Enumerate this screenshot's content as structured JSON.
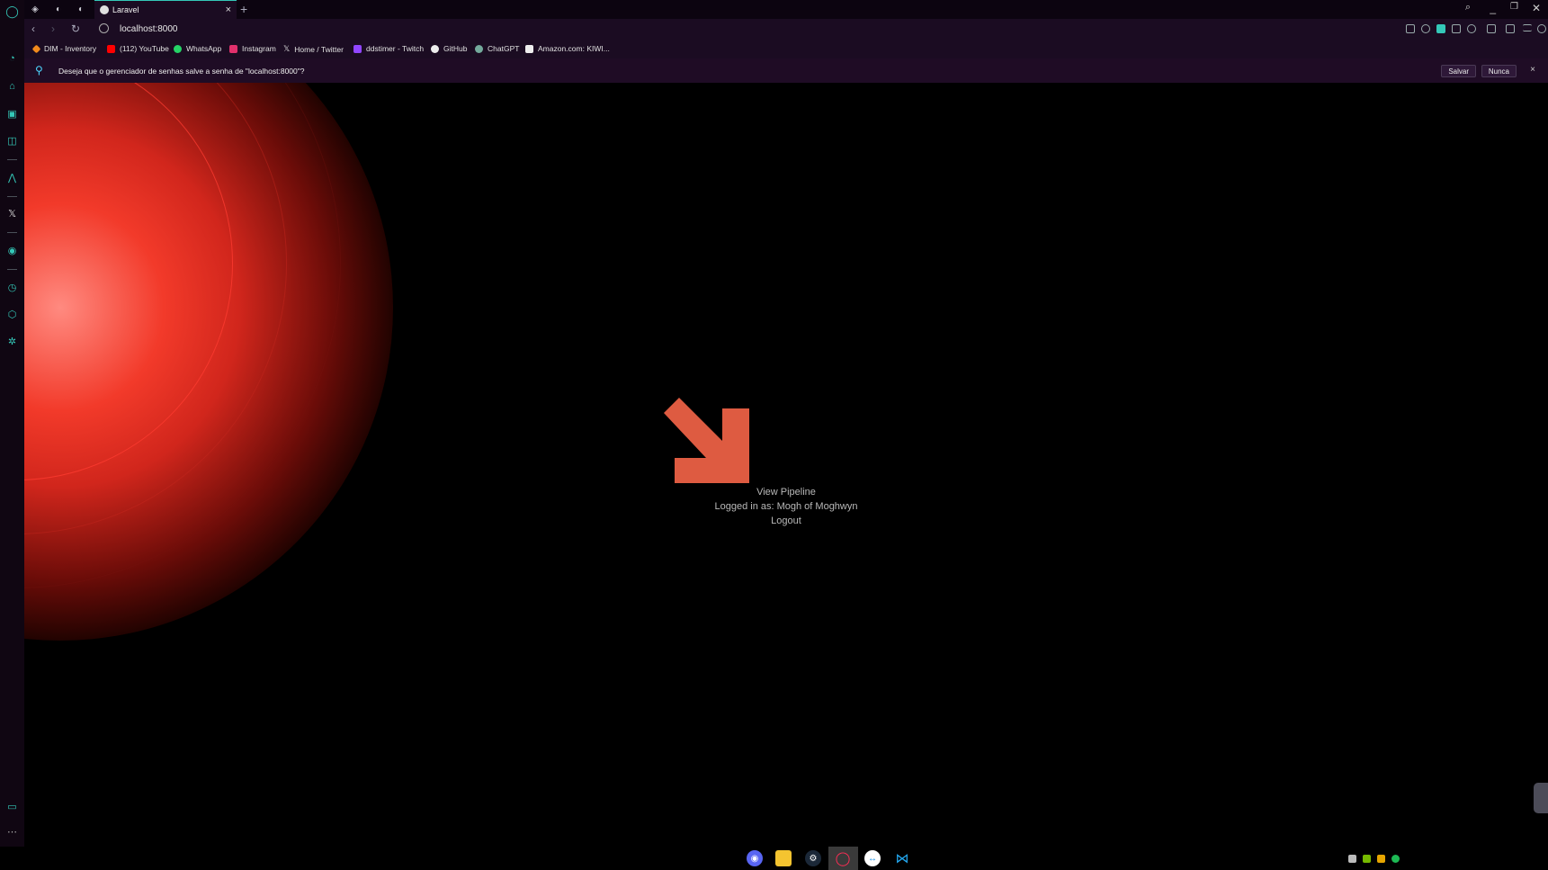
{
  "browser": {
    "active_tab_title": "Laravel",
    "new_tab_glyph": "+",
    "close_tab_glyph": "×",
    "url": "localhost:8000",
    "accent_color": "#34c8b8"
  },
  "bookmarks": [
    {
      "label": "DIM - Inventory",
      "icon": "dim-icon",
      "color": "#f08a1c"
    },
    {
      "label": "(112) YouTube",
      "icon": "youtube-icon",
      "color": "#ff0000"
    },
    {
      "label": "WhatsApp",
      "icon": "whatsapp-icon",
      "color": "#25d366"
    },
    {
      "label": "Instagram",
      "icon": "instagram-icon",
      "color": "#e1306c"
    },
    {
      "label": "Home / Twitter",
      "icon": "x-icon",
      "color": "#dddddd"
    },
    {
      "label": "ddstimer - Twitch",
      "icon": "twitch-icon",
      "color": "#9146ff"
    },
    {
      "label": "GitHub",
      "icon": "github-icon",
      "color": "#eeeeee"
    },
    {
      "label": "ChatGPT",
      "icon": "chatgpt-icon",
      "color": "#74aa9c"
    },
    {
      "label": "Amazon.com: KIWI...",
      "icon": "amazon-icon",
      "color": "#eeeeee"
    }
  ],
  "infobar": {
    "message": "Deseja que o gerenciador de senhas salve a senha de \"localhost:8000\"?",
    "save_label": "Salvar",
    "never_label": "Nunca",
    "close_glyph": "×"
  },
  "page": {
    "logo_color": "#de5b41",
    "links": {
      "view_pipeline": "View Pipeline",
      "logged_in": "Logged in as: Mogh of Moghwyn",
      "logout": "Logout"
    }
  },
  "taskbar": {
    "apps": [
      "discord-icon",
      "file-explorer-icon",
      "steam-icon",
      "opera-gx-icon",
      "teamviewer-icon",
      "vscode-icon"
    ],
    "active_app": "opera-gx-icon"
  }
}
